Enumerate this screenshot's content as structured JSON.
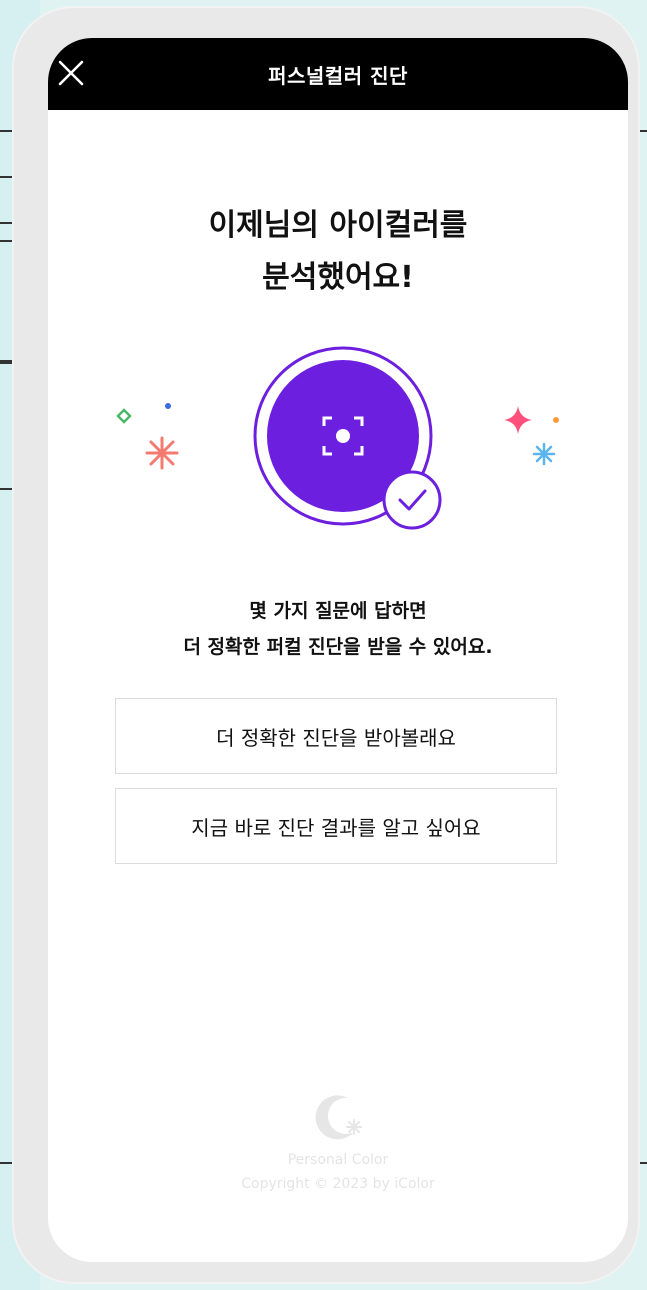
{
  "topbar": {
    "title": "퍼스널컬러 진단"
  },
  "heading": {
    "line1": "이제님의 아이컬러를",
    "line2": "분석했어요!"
  },
  "question": {
    "line1": "몇 가지 질문에 답하면",
    "line2": "더 정확한 퍼컬 진단을 받을 수 있어요."
  },
  "options": {
    "detailed": "더 정확한 진단을 받아볼래요",
    "now": "지금 바로 진단 결과를 알고 싶어요"
  },
  "footer": {
    "line1": "Personal Color",
    "line2": "Copyright © 2023 by iColor"
  },
  "colors": {
    "accent": "#6d1fe0",
    "topbar": "#000000",
    "background": "#dff3f3"
  },
  "icons": [
    "close-icon",
    "focus-camera-icon",
    "check-icon",
    "sparkle-icon",
    "brand-logo-icon"
  ]
}
